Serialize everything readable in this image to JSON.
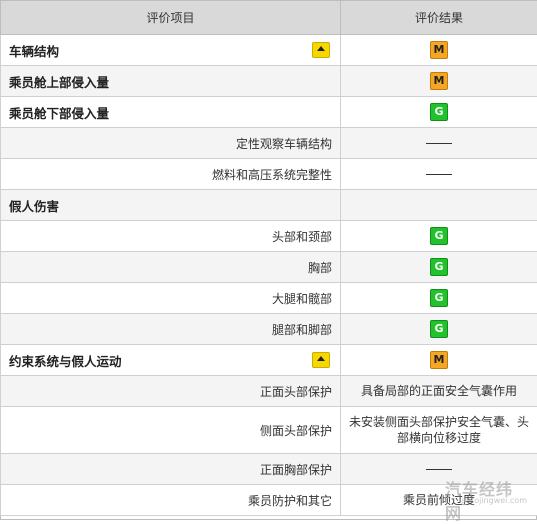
{
  "table": {
    "headers": [
      "评价项目",
      "评价结果"
    ],
    "rows": [
      {
        "label": "车辆结构",
        "kind": "category",
        "arrow": true,
        "result": {
          "type": "badge",
          "value": "M"
        }
      },
      {
        "label": "乘员舱上部侵入量",
        "kind": "category",
        "arrow": false,
        "result": {
          "type": "badge",
          "value": "M"
        }
      },
      {
        "label": "乘员舱下部侵入量",
        "kind": "category",
        "arrow": false,
        "result": {
          "type": "badge",
          "value": "G"
        }
      },
      {
        "label": "定性观察车辆结构",
        "kind": "sub",
        "result": {
          "type": "dash"
        }
      },
      {
        "label": "燃料和高压系统完整性",
        "kind": "sub",
        "result": {
          "type": "dash"
        }
      },
      {
        "label": "假人伤害",
        "kind": "category",
        "arrow": false,
        "result": {
          "type": "empty"
        }
      },
      {
        "label": "头部和颈部",
        "kind": "sub",
        "result": {
          "type": "badge",
          "value": "G"
        }
      },
      {
        "label": "胸部",
        "kind": "sub",
        "result": {
          "type": "badge",
          "value": "G"
        }
      },
      {
        "label": "大腿和髋部",
        "kind": "sub",
        "result": {
          "type": "badge",
          "value": "G"
        }
      },
      {
        "label": "腿部和脚部",
        "kind": "sub",
        "result": {
          "type": "badge",
          "value": "G"
        }
      },
      {
        "label": "约束系统与假人运动",
        "kind": "category",
        "arrow": true,
        "result": {
          "type": "badge",
          "value": "M"
        }
      },
      {
        "label": "正面头部保护",
        "kind": "sub",
        "result": {
          "type": "text",
          "value": "具备局部的正面安全气囊作用"
        }
      },
      {
        "label": "侧面头部保护",
        "kind": "sub",
        "tall": true,
        "result": {
          "type": "text",
          "value": "未安装侧面头部保护安全气囊、头部横向位移过度"
        }
      },
      {
        "label": "正面胸部保护",
        "kind": "sub",
        "result": {
          "type": "dash"
        }
      },
      {
        "label": "乘员防护和其它",
        "kind": "sub",
        "result": {
          "type": "text",
          "value": "乘员前倾过度"
        }
      }
    ]
  },
  "watermark": {
    "title": "汽车经纬网",
    "subtitle": "autojingwei.com"
  },
  "colors": {
    "header_bg": "#d9d9d9",
    "badge_M": "#f5a623",
    "badge_G": "#22c22c",
    "arrow_icon": "#f6d800"
  }
}
